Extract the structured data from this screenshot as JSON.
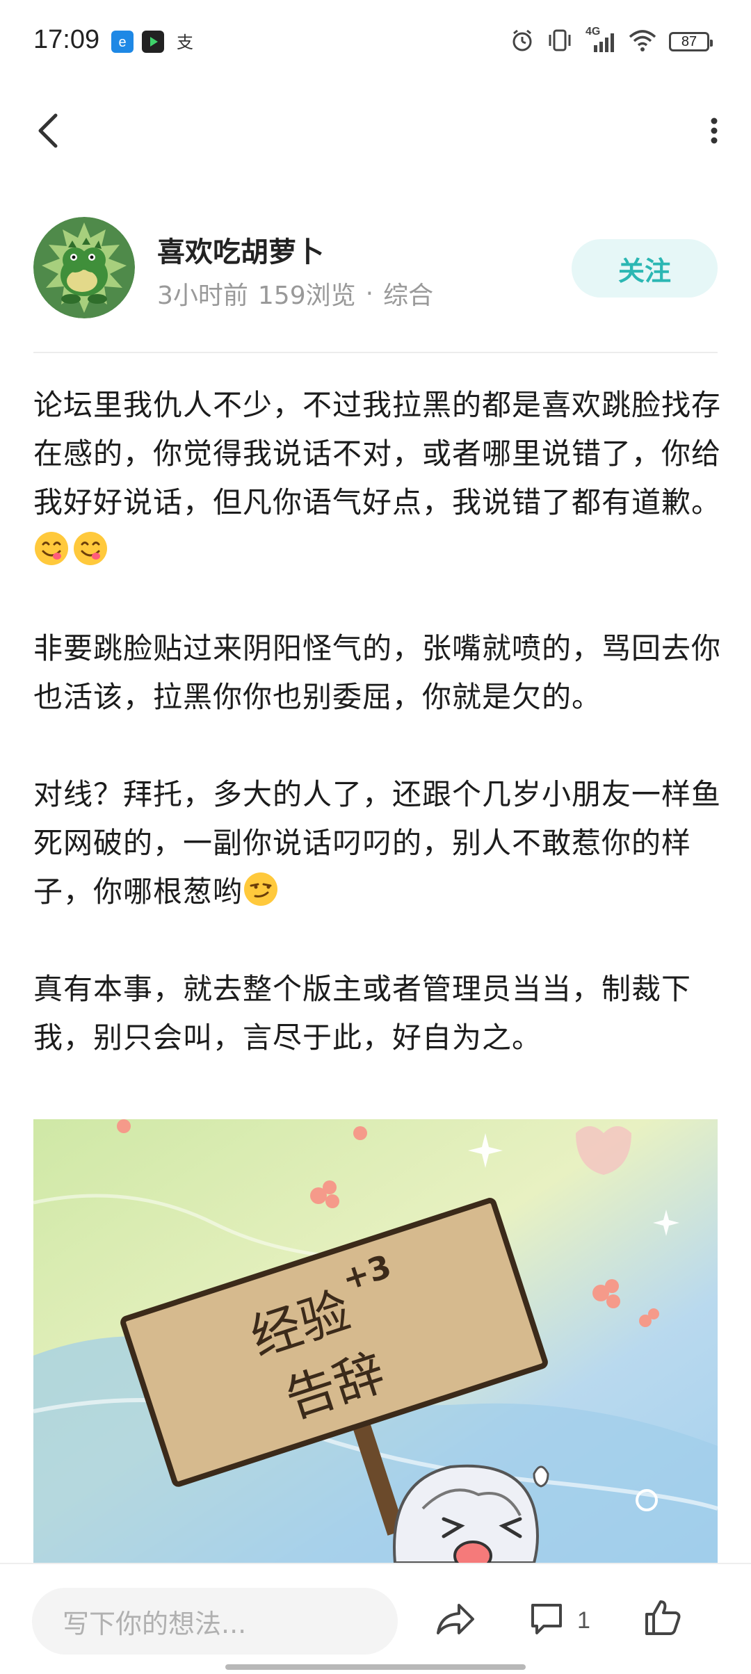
{
  "status_bar": {
    "time": "17:09",
    "network": "4G",
    "battery": "87",
    "left_icons": [
      "browser-app-icon",
      "video-app-icon",
      "alipay-app-icon"
    ],
    "right_icons": [
      "alarm-icon",
      "vibrate-icon",
      "signal-icon",
      "wifi-icon",
      "battery-icon"
    ]
  },
  "nav": {
    "back_icon": "chevron-left-icon",
    "more_icon": "more-vertical-icon"
  },
  "author": {
    "name": "喜欢吃胡萝卜",
    "time_ago": "3小时前",
    "views": "159浏览",
    "separator": "·",
    "category": "综合",
    "follow_label": "关注"
  },
  "post": {
    "paragraphs": [
      "论坛里我仇人不少，不过我拉黑的都是喜欢跳脸找存在感的，你觉得我说话不对，或者哪里说错了，你给我好好说话，但凡你语气好点，我说错了都有道歉。",
      "非要跳脸贴过来阴阳怪气的，张嘴就喷的，骂回去你也活该，拉黑你你也别委屈，你就是欠的。",
      "对线？拜托，多大的人了，还跟个几岁小朋友一样鱼死网破的，一副你说话叼叼的，别人不敢惹你的样子，你哪根葱哟",
      "真有本事，就去整个版主或者管理员当当，制裁下我，别只会叫，言尽于此，好自为之。"
    ],
    "image": {
      "sign_line1": "经验",
      "sign_plus": "+3",
      "sign_line2": "告辞"
    }
  },
  "bottom_bar": {
    "comment_placeholder": "写下你的想法...",
    "comment_count": "1",
    "share_icon": "share-icon",
    "comment_icon": "comment-icon",
    "like_icon": "thumbs-up-icon"
  },
  "colors": {
    "accent": "#2bb7b3",
    "follow_bg": "#e6f7f7",
    "meta_text": "#999999"
  }
}
